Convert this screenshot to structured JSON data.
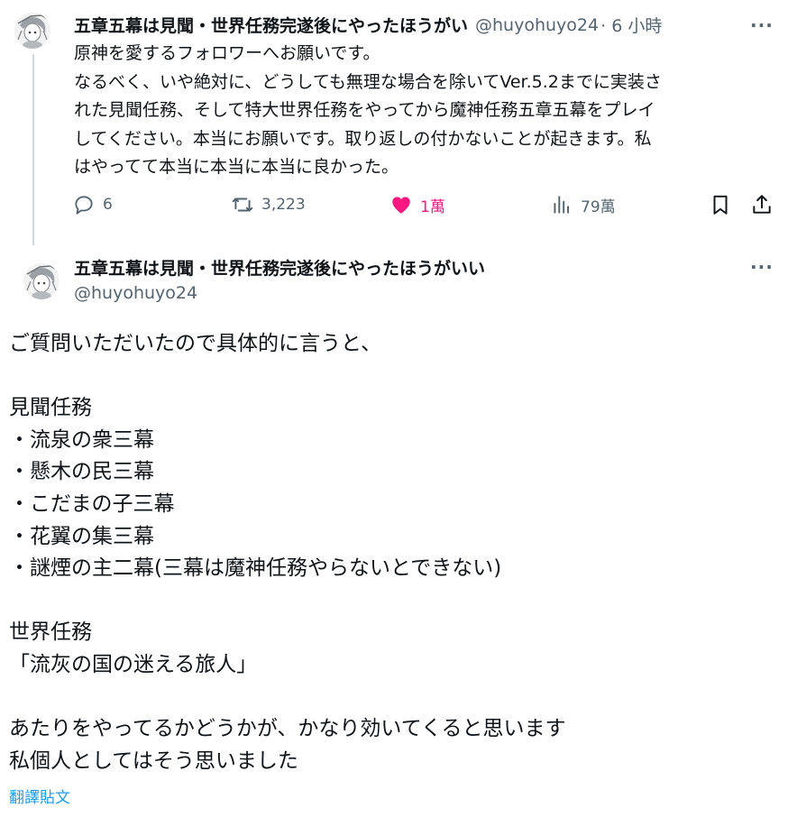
{
  "tweet1": {
    "display_name": "五章五幕は見聞・世界任務完遂後にやったほうがい",
    "handle": "@huyohuyo24",
    "time": "· 6 小時",
    "more": "···",
    "text_lines": [
      "原神を愛するフォロワーへお願いです。",
      "なるべく、いや絶対に、どうしても無理な場合を除いてVer.5.2までに実装さ",
      "れた見聞任務、そして特大世界任務をやってから魔神任務五章五幕をプレイ",
      "してください。本当にお願いです。取り返しの付かないことが起きます。私",
      "はやってて本当に本当に本当に良かった。"
    ],
    "actions": {
      "replies": "6",
      "reposts": "3,223",
      "likes": "1萬",
      "views": "79萬"
    }
  },
  "tweet2": {
    "display_name": "五章五幕は見聞・世界任務完遂後にやったほうがいい",
    "handle": "@huyohuyo24",
    "more": "···",
    "lines": [
      "ご質問いただいたので具体的に言うと、",
      "",
      "見聞任務",
      "・流泉の衆三幕",
      "・懸木の民三幕",
      "・こだまの子三幕",
      "・花翼の集三幕",
      "・謎煙の主二幕(三幕は魔神任務やらないとできない)",
      "",
      "世界任務",
      "「流灰の国の迷える旅人」",
      "",
      "あたりをやってるかどうかが、かなり効いてくると思います",
      "私個人としてはそう思いました"
    ],
    "translate_label": "翻譯貼文"
  },
  "colors": {
    "text": "#0f1419",
    "secondary": "#536471",
    "like": "#f91880",
    "link": "#1d9bf0",
    "thread_line": "#cfd9de"
  }
}
